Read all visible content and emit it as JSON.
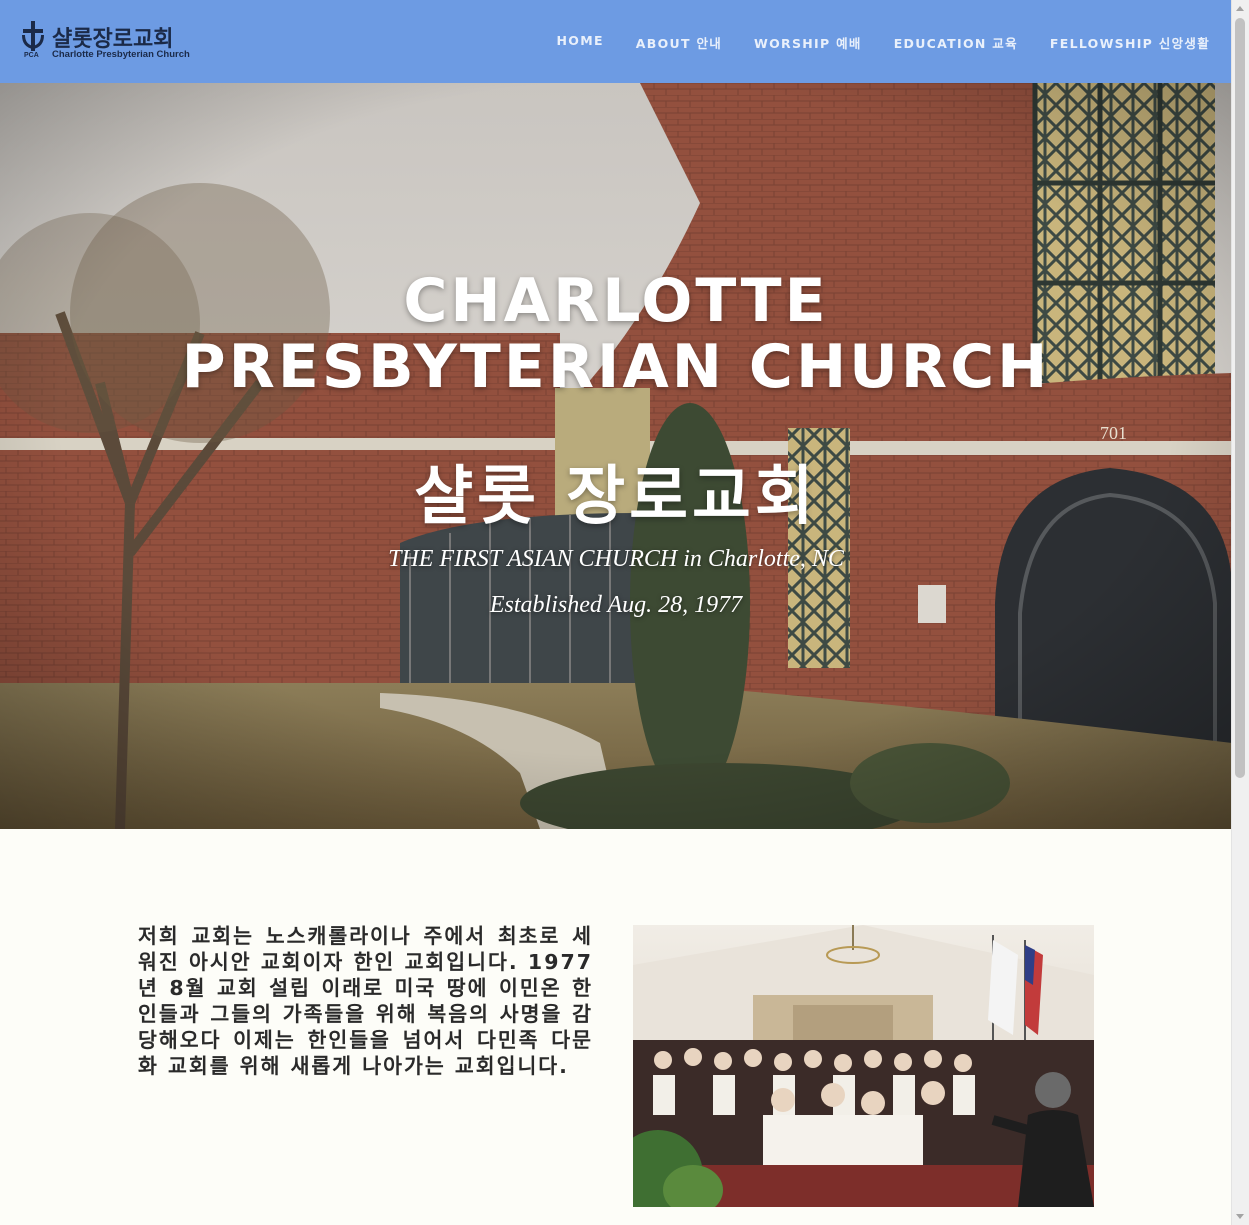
{
  "header": {
    "logo": {
      "name_ko": "샬롯장로교회",
      "name_en": "Charlotte Presbyterian Church",
      "denomination": "PCA"
    },
    "nav": [
      {
        "label": "HOME"
      },
      {
        "label": "ABOUT 안내"
      },
      {
        "label": "WORSHIP 예배"
      },
      {
        "label": "EDUCATION 교육"
      },
      {
        "label": "FELLOWSHIP 신앙생활"
      }
    ]
  },
  "hero": {
    "title_line1": "CHARLOTTE",
    "title_line2": "PRESBYTERIAN CHURCH",
    "title_ko": "샬롯 장로교회",
    "subtitle": "THE FIRST ASIAN CHURCH in Charlotte, NC",
    "established": "Established Aug. 28, 1977",
    "building_number": "701"
  },
  "intro": {
    "text": "저희 교회는 노스캐롤라이나 주에서 최초로 세워진 아시안 교회이자 한인 교회입니다. 1977년 8월 교회 설립 이래로 미국 땅에 이민온 한인들과 그들의 가족들을 위해 복음의 사명을 감당해오다 이제는 한인들을 넘어서 다민족 다문화 교회를 위해 새롭게 나아가는 교회입니다."
  },
  "colors": {
    "header_bg": "#6d9be3",
    "nav_text": "#e9f0fb",
    "logo_text": "#1b2a48",
    "page_bg": "#fdfdf8",
    "body_text": "#2a2a2a"
  }
}
